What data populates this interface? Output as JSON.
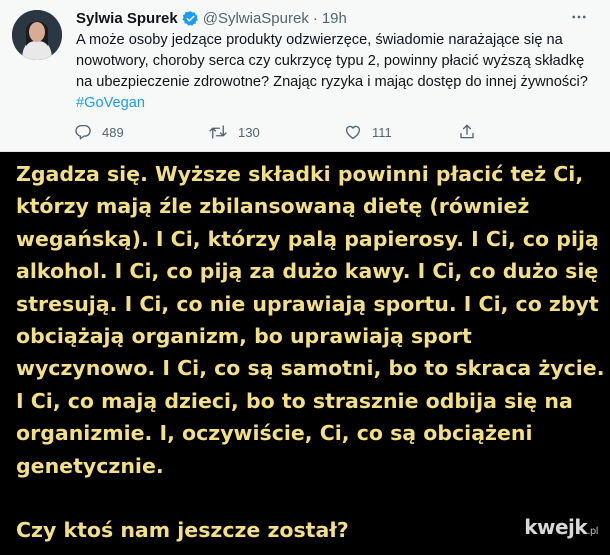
{
  "tweet": {
    "author_name": "Sylwia Spurek",
    "handle": "@SylwiaSpurek",
    "separator": "·",
    "time": "19h",
    "text": "A może osoby jedzące produkty odzwierzęce, świadomie narażające się na nowotwory, choroby serca czy cukrzycę typu 2, powinny płacić wyższą składkę na ubezpieczenie zdrowotne? Znając ryzyka i mając dostęp do innej żywności? ",
    "hashtag": "#GoVegan",
    "replies": "489",
    "retweets": "130",
    "likes": "111",
    "colors": {
      "hashtag": "#1d9bf0",
      "verified": "#1d9bf0",
      "text": "#0f1419",
      "muted": "#536471"
    },
    "icons": [
      "verified-icon",
      "more-icon",
      "reply-icon",
      "retweet-icon",
      "like-icon",
      "share-icon"
    ]
  },
  "meme": {
    "text": "Zgadza się. Wyższe składki powinni płacić też Ci, którzy mają źle zbilansowaną dietę (również wegańską). I Ci, którzy palą papierosy. I Ci, co piją alkohol. I Ci, co piją za dużo kawy. I Ci, co dużo się stresują. I Ci, co nie uprawiają sportu. I Ci, co zbyt obciążają organizm, bo uprawiają sport wyczynowo. I Ci, co są samotni, bo to skraca życie. I Ci, co mają dzieci, bo to strasznie odbija się na organizmie. I, oczywiście, Ci, co są obciążeni genetycznie.\n\nCzy ktoś nam jeszcze został?",
    "text_color": "#f3df86",
    "background": "#000000"
  },
  "watermark": {
    "main": "kwejk",
    "suffix": ".pl"
  }
}
